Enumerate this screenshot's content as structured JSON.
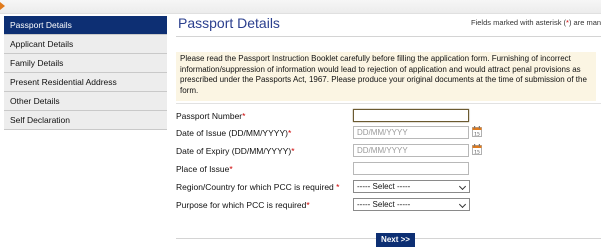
{
  "sidebar": {
    "items": [
      {
        "label": "Passport Details",
        "active": true
      },
      {
        "label": "Applicant Details",
        "active": false
      },
      {
        "label": "Family Details",
        "active": false
      },
      {
        "label": "Present Residential Address",
        "active": false
      },
      {
        "label": "Other Details",
        "active": false
      },
      {
        "label": "Self Declaration",
        "active": false
      }
    ]
  },
  "main": {
    "title": "Passport Details",
    "asterisk_note_prefix": "Fields marked with asterisk (",
    "asterisk_star": "*",
    "asterisk_note_suffix": ") are mand",
    "notice": "Please read the Passport Instruction Booklet carefully before filling the application form. Furnishing of incorrect information/suppression of information would lead to rejection of application and would attract penal provisions as prescribed under the Passports Act, 1967. Please produce your original documents at the time of submission of the form."
  },
  "form": {
    "passport_number": {
      "label": "Passport Number",
      "req": "*",
      "value": ""
    },
    "date_of_issue": {
      "label": "Date of Issue (DD/MM/YYYY)",
      "req": "*",
      "placeholder": "DD/MM/YYYY"
    },
    "date_of_expiry": {
      "label": "Date of Expiry (DD/MM/YYYY)",
      "req": "*",
      "placeholder": "DD/MM/YYYY"
    },
    "place_of_issue": {
      "label": "Place of Issue",
      "req": "*",
      "value": ""
    },
    "region_country": {
      "label": "Region/Country for which PCC is required ",
      "req": "*",
      "selected": "----- Select -----"
    },
    "purpose": {
      "label": "Purpose for which PCC is required",
      "req": "*",
      "selected": "----- Select -----"
    }
  },
  "actions": {
    "next_label": "Next >>"
  },
  "colors": {
    "nav_active": "#0d2f73",
    "title": "#2b3f8e",
    "required": "#cc0000",
    "notice_bg": "#fbf5e3",
    "calendar_icon": "#e07a1c"
  },
  "icons": {
    "calendar": "calendar-icon",
    "dropdown": "chevron-down-icon",
    "header_arrow": "arrow-right-icon"
  }
}
